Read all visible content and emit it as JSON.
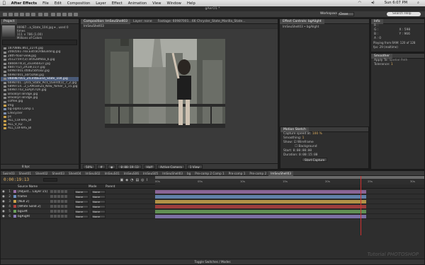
{
  "menubar": {
    "app": "After Effects",
    "items": [
      "File",
      "Edit",
      "Composition",
      "Layer",
      "Effect",
      "Animation",
      "View",
      "Window",
      "Help"
    ],
    "clock": "Sun 6:07 PM"
  },
  "window": {
    "title": "gAerO1 *"
  },
  "toolbar": {
    "workspace_label": "Workspace:",
    "workspace_value": "Clean",
    "search_placeholder": "Search Help"
  },
  "project": {
    "tab": "Project",
    "selected_name": "06987…a_State_104.jpg ▾ , used 0 times",
    "selected_dims": "111 × 786 (1.00)",
    "selected_colors": "Millions of Colors",
    "items": [
      {
        "name": "187088E.861_2274.jpg",
        "type": "file"
      },
      {
        "name": "2060561-7ex.ExtraOrdBuilding.jpg",
        "type": "file"
      },
      {
        "name": "28th-floor-view.jpg",
        "type": "file"
      },
      {
        "name": "35127597(3) afc628f6ba_b.jpg",
        "type": "file"
      },
      {
        "name": "4866974(3)_2a1e6b437.jpg",
        "type": "file"
      },
      {
        "name": "48d77(2)_2R18(11)7.jpg",
        "type": "file"
      },
      {
        "name": "60987001.st0b25bf1B2.jpg",
        "type": "file"
      },
      {
        "name": "66987001_a0r5D6B.jpg",
        "type": "file"
      },
      {
        "name": "066987001_2IClntbExnd_State_104.jpg",
        "type": "file",
        "selected": true
      },
      {
        "name": "6698701...ynra_State_Pics_Overst(1)_7_2.jpg",
        "type": "file"
      },
      {
        "name": "6899714...2_LAM1Bn2a_New_Yorker_1_15.jpg",
        "type": "file"
      },
      {
        "name": "66987743_a3Ajm7Dn.jpg",
        "type": "file"
      },
      {
        "name": "Brooklyn Bridge.jpg",
        "type": "file"
      },
      {
        "name": "Brooklyn Bridge.jpg",
        "type": "file"
      },
      {
        "name": "coffee.jpg",
        "type": "file"
      },
      {
        "name": "Img",
        "type": "folder"
      },
      {
        "name": "bg-alpha Comp 1",
        "type": "comp"
      },
      {
        "name": "Lifecycler",
        "type": "comp"
      },
      {
        "name": "ps",
        "type": "folder"
      },
      {
        "name": "ALL_CUFRAS_BI",
        "type": "folder"
      },
      {
        "name": "ALL_V_R2",
        "type": "folder"
      },
      {
        "name": "ALL_CUFRAS_BI",
        "type": "folder"
      }
    ],
    "footer_bpc": "8 bpc"
  },
  "composition": {
    "tab": "Composition: ImSeuShell03",
    "layer_tab": "Layer: none",
    "footage_tab": "Footage: 60987001...66 Chrysler_State_Marilla_State...",
    "sub_tab": "ImSeuShell03",
    "zoom": "50%",
    "timecode": "0:00:19:13",
    "view_quality": "Half",
    "camera": "Active Camera",
    "views": "1 View"
  },
  "effect_controls": {
    "tab": "Effect Controls: bgAlight",
    "subtitle": "ImSeuShell03 • bgAlight"
  },
  "info": {
    "tab": "Info",
    "r": "R :",
    "g": "G :",
    "b": "B :",
    "a": "A : 0",
    "x": "X : 598",
    "y": "Y : 966",
    "line1": "Playing from RAM: 120 of 128",
    "line2": "fps: 29 (realtime)"
  },
  "smoother": {
    "tab": "Smoother",
    "apply_to": "Apply To:",
    "apply_value": "Spatial Path",
    "tolerance": "Tolerance:",
    "tolerance_value": "1"
  },
  "motion_sketch": {
    "tab": "Motion Sketch",
    "capture_speed_label": "Capture speed at:",
    "capture_speed_value": "100 %",
    "smoothing_label": "Smoothing:",
    "smoothing_value": "1",
    "show_label": "Show:",
    "wireframe": "Wireframe",
    "background": "Background",
    "start_label": "Start:",
    "start_value": "0:00:00:00",
    "duration_label": "Duration:",
    "duration_value": "0:00:15:00",
    "start_capture": "Start Capture"
  },
  "timeline": {
    "tabs": [
      "Swim03",
      "Sheet01",
      "Sheet02",
      "Sheet03",
      "Sheet04",
      "ImSeuS02",
      "ImSeuS01",
      "ImSeuS06",
      "ImSeuS05",
      "ImSeuShell03",
      "bg",
      "Pre-comp 2 Comp 1",
      "Pre-comp 1",
      "Pre-comp 2",
      "ImSeuShell03"
    ],
    "timecode": "0:00:19:13",
    "columns": {
      "source": "Source Name",
      "mode": "Mode",
      "parent": "Parent"
    },
    "layers": [
      {
        "num": "1",
        "name": "[Adjust... Layer 15]",
        "mode": "None",
        "color": "#9a6ea8"
      },
      {
        "num": "2",
        "name": "frame",
        "mode": "None",
        "color": "#6a8fbf"
      },
      {
        "num": "3",
        "name": "[Null 2]",
        "mode": "None",
        "color": "#c9a24a"
      },
      {
        "num": "4",
        "name": "[White Solid 2]",
        "mode": "None",
        "color": "#b04040"
      },
      {
        "num": "5",
        "name": "bgLeft",
        "mode": "None",
        "color": "#6aa05a"
      },
      {
        "num": "6",
        "name": "bgRight",
        "mode": "None",
        "color": "#8a7ab8"
      }
    ],
    "ruler_marks": [
      "00s",
      "05s",
      "10s",
      "15s",
      "20s",
      "25s",
      "30s"
    ],
    "footer": "Toggle Switches / Modes"
  },
  "watermark": "Tutorial PHOTOSHOP"
}
